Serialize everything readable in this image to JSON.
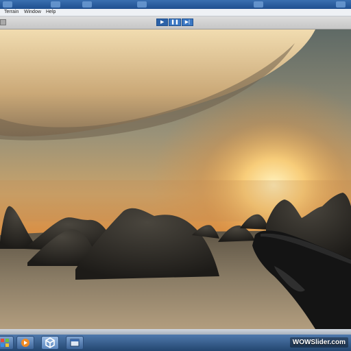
{
  "menubar": {
    "items": [
      "Terrain",
      "Window",
      "Help"
    ]
  },
  "toolbar": {
    "play_icons": [
      "play-icon",
      "pause-icon",
      "step-icon"
    ]
  },
  "taskbar": {
    "icons": [
      "windows-start-icon",
      "media-player-icon",
      "unity-icon",
      "window-icon"
    ]
  },
  "watermark": "WOWSlider.com",
  "colors": {
    "title_blue": "#2a5c9d",
    "play_blue": "#3b78c4",
    "taskbar_blue": "#345b8c"
  }
}
